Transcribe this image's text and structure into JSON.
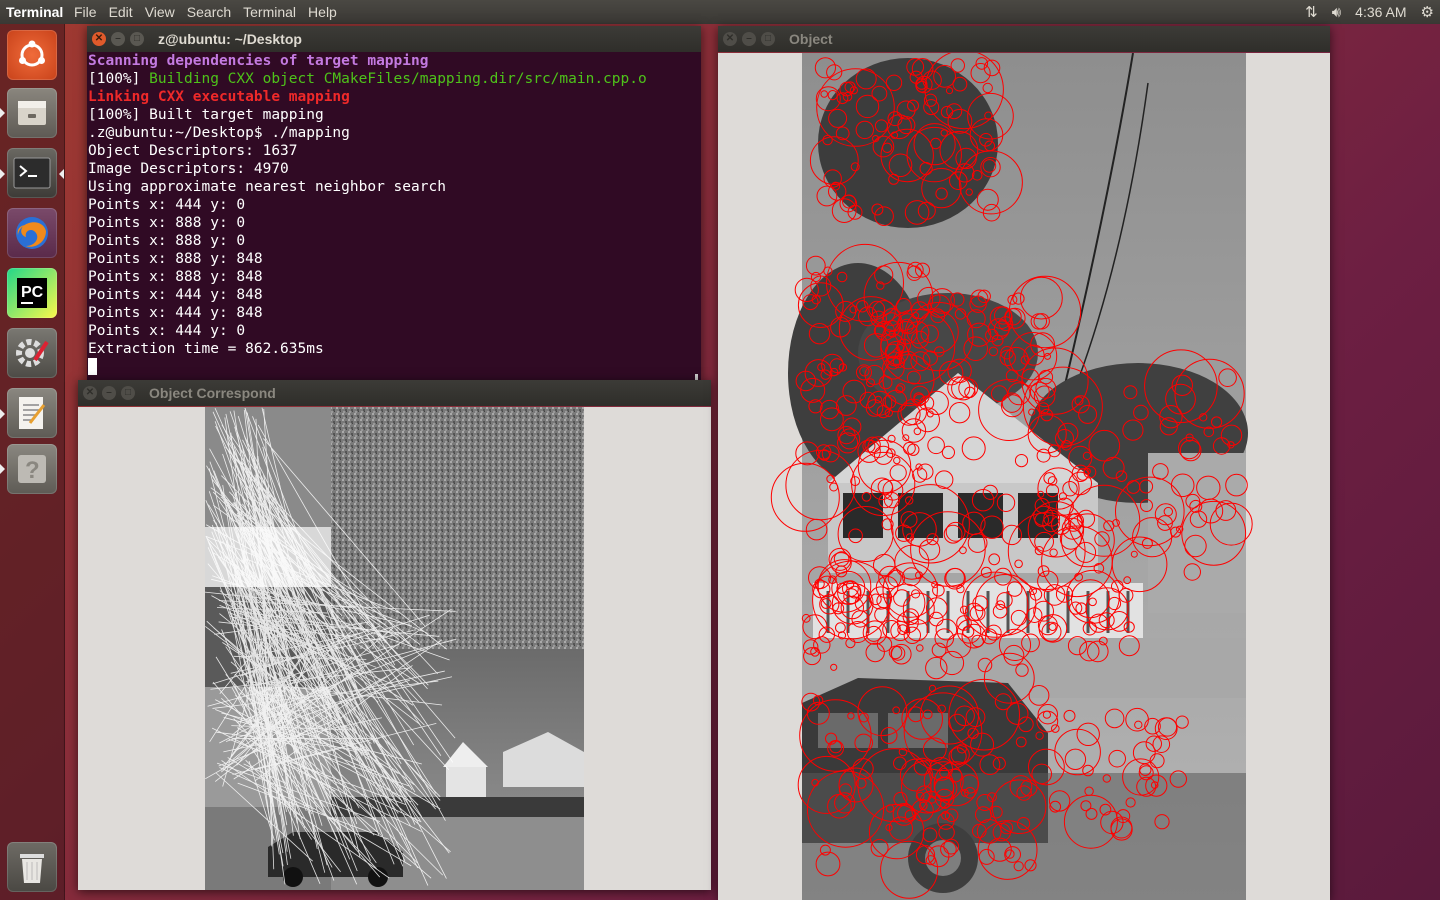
{
  "top_panel": {
    "app_title": "Terminal",
    "menus": [
      "File",
      "Edit",
      "View",
      "Search",
      "Terminal",
      "Help"
    ],
    "time": "4:36 AM"
  },
  "launcher": {
    "items": [
      "ubuntu-dash",
      "files",
      "terminal",
      "firefox",
      "pycharm",
      "system-settings",
      "text-editor",
      "help",
      "trash"
    ]
  },
  "terminal": {
    "title": "z@ubuntu: ~/Desktop",
    "lines": [
      {
        "text": "Scanning dependencies of target mapping",
        "style": "magenta"
      },
      {
        "prefix": "[100%] ",
        "text": "Building CXX object CMakeFiles/mapping.dir/src/main.cpp.o",
        "style": "green"
      },
      {
        "text": "Linking CXX executable mapping",
        "style": "red"
      },
      {
        "text": "[100%] Built target mapping",
        "style": "plain"
      },
      {
        "text": ".z@ubuntu:~/Desktop$ ./mapping",
        "style": "plain"
      },
      {
        "text": "Object Descriptors: 1637",
        "style": "plain"
      },
      {
        "text": "Image Descriptors: 4970",
        "style": "plain"
      },
      {
        "text": "Using approximate nearest neighbor search",
        "style": "plain"
      },
      {
        "text": "Points x: 444 y: 0",
        "style": "plain"
      },
      {
        "text": "Points x: 888 y: 0",
        "style": "plain"
      },
      {
        "text": "Points x: 888 y: 0",
        "style": "plain"
      },
      {
        "text": "Points x: 888 y: 848",
        "style": "plain"
      },
      {
        "text": "Points x: 888 y: 848",
        "style": "plain"
      },
      {
        "text": "Points x: 444 y: 848",
        "style": "plain"
      },
      {
        "text": "Points x: 444 y: 848",
        "style": "plain"
      },
      {
        "text": "Points x: 444 y: 0",
        "style": "plain"
      },
      {
        "text": "Extraction time = 862.635ms",
        "style": "plain"
      }
    ]
  },
  "correspond_window": {
    "title": "Object Correspond"
  },
  "object_window": {
    "title": "Object"
  },
  "colors": {
    "terminal_bg": "#300a24",
    "keypoint": "#ff0000",
    "match_lines": "#ffffff",
    "close_button": "#e05a2b"
  }
}
